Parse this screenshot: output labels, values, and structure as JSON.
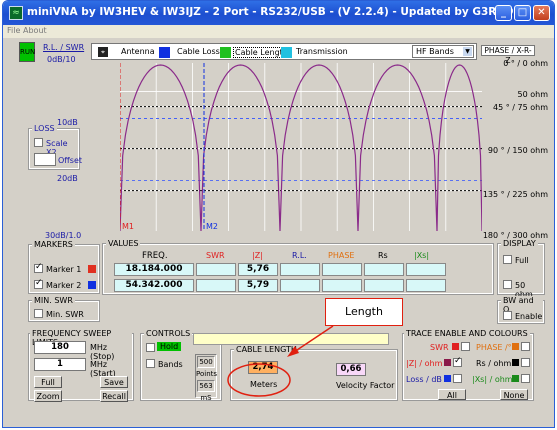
{
  "window": {
    "title": "miniVNA by IW3HEV & IW3IJZ - 2 Port - RS232/USB -  (V 2.2.4) - Updated by G3RXQ"
  },
  "menu": [
    "File",
    "About"
  ],
  "toolbar": {
    "run": "RUN",
    "rl_swr": "R.L. / SWR",
    "scale_top": "0dB/10",
    "items": [
      "Antenna",
      "Cable Loss",
      "Cable Length",
      "Transmission"
    ],
    "band_select": "HF Bands",
    "phase_title": "PHASE / X-R-Z"
  },
  "left_scale": [
    "10dB",
    "20dB",
    "30dB/1.0"
  ],
  "right_scale": [
    "0 ° / 0 ohm",
    "50 ohm",
    "45 ° / 75 ohm",
    "90 ° / 150 ohm",
    "135 ° / 225 ohm",
    "180 ° / 300 ohm"
  ],
  "markers_on_plot": [
    "M1",
    "M2"
  ],
  "loss": {
    "title": "LOSS",
    "scale_label": "Scale X2",
    "offset_label": "Offset"
  },
  "markers": {
    "title": "MARKERS",
    "m1": "Marker 1",
    "m2": "Marker 2",
    "m1_color": "#e03020",
    "m2_color": "#1030e0"
  },
  "values": {
    "title": "VALUES",
    "headers": [
      "FREQ.",
      "SWR",
      "|Z|",
      "R.L.",
      "PHASE",
      "Rs",
      "|Xs|"
    ],
    "header_colors": [
      "#000000",
      "#e02020",
      "#e02020",
      "#1a1aa6",
      "#e07010",
      "#000000",
      "#1a8a1a"
    ],
    "rows": [
      [
        "18.184.000",
        "",
        "5,76",
        "",
        "",
        "",
        ""
      ],
      [
        "54.342.000",
        "",
        "5,79",
        "",
        "",
        "",
        ""
      ]
    ]
  },
  "display": {
    "title": "DISPLAY",
    "full": "Full",
    "ohm50": "50 ohm"
  },
  "bwq": {
    "title": "BW and Q",
    "enable": "Enable"
  },
  "min_swr": {
    "title": "MIN. SWR",
    "label": "Min. SWR"
  },
  "sweep": {
    "title": "FREQUENCY SWEEP LIMITS",
    "stop_value": "180",
    "stop_label": "MHz (Stop)",
    "start_value": "1",
    "start_label": "MHz (Start)",
    "full": "Full",
    "save": "Save",
    "zoom": "Zoom",
    "recall": "Recall"
  },
  "controls": {
    "title": "CONTROLS",
    "hold": "Hold",
    "bands": "Bands",
    "points_value": "500",
    "points_label": "Points",
    "ms_value": "563",
    "ms_label": "mS"
  },
  "cable": {
    "title": "CABLE LENGTH",
    "length_value": "2,74",
    "length_unit": "Meters",
    "vf_value": "0,66",
    "vf_label": "Velocity Factor"
  },
  "annotation": {
    "label": "Length"
  },
  "trace": {
    "title": "TRACE ENABLE AND COLOURS",
    "swr": "SWR",
    "phase": "PHASE /°",
    "z": "|Z| / ohm",
    "rs": "Rs / ohm",
    "loss": "Loss / dB",
    "xs": "|Xs| / ohm",
    "all": "All",
    "none": "None"
  },
  "colors": {
    "trace": "#8a2a8a",
    "grid": "#d8d8d8",
    "dash_white": "#ffffff",
    "dash_blue": "#3050ff",
    "green_run": "#00c000"
  }
}
